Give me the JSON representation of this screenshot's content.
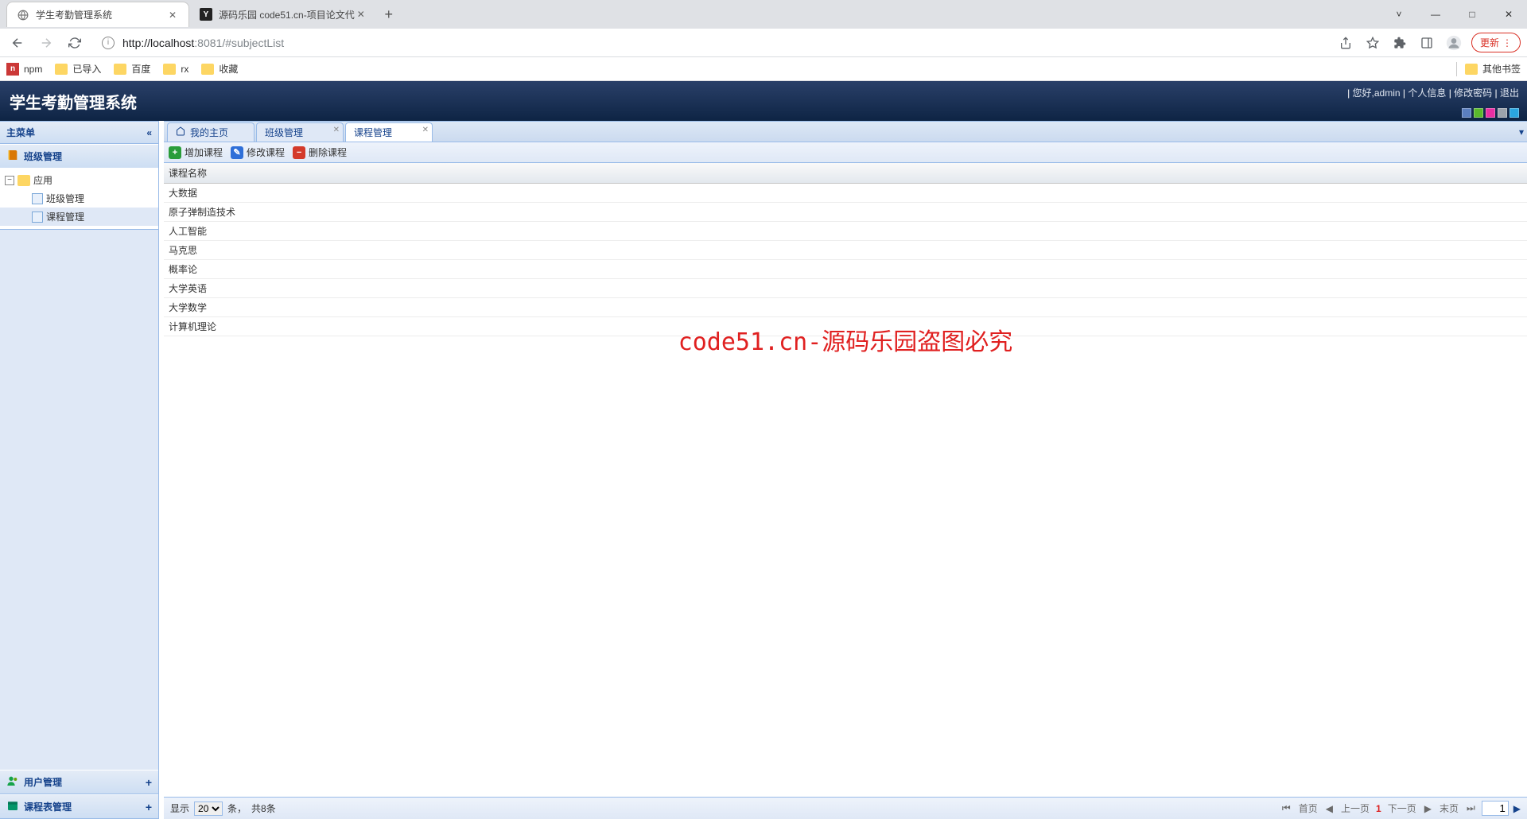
{
  "browser": {
    "tabs": [
      {
        "title": "学生考勤管理系统",
        "icon": "globe",
        "active": true
      },
      {
        "title": "源码乐园 code51.cn-项目论文代",
        "icon": "y",
        "active": false
      }
    ],
    "url_host": "http://localhost",
    "url_port": ":8081",
    "url_path": "/#subjectList",
    "update_label": "更新",
    "window_controls": {
      "min": "—",
      "max": "□",
      "close": "✕",
      "chevron": "˅"
    },
    "bookmarks": {
      "npm": "npm",
      "items": [
        "已导入",
        "百度",
        "rx",
        "收藏"
      ],
      "other": "其他书签"
    }
  },
  "header": {
    "title": "学生考勤管理系统",
    "links": {
      "greeting": "您好,admin",
      "profile": "个人信息",
      "changepw": "修改密码",
      "logout": "退出"
    },
    "sep": " | ",
    "swatches": [
      "#5b7fbf",
      "#5ab92c",
      "#e82fa3",
      "#9ca3ab",
      "#2aa6e0"
    ]
  },
  "sidebar": {
    "main_menu": "主菜单",
    "sections": {
      "class_mgmt": "班级管理",
      "user_mgmt": "用户管理",
      "schedule_mgmt": "课程表管理"
    },
    "tree": {
      "app": "应用",
      "class_mgmt": "班级管理",
      "course_mgmt": "课程管理"
    }
  },
  "tabs": {
    "home": "我的主页",
    "class": "班级管理",
    "course": "课程管理"
  },
  "toolbar": {
    "add": "增加课程",
    "edit": "修改课程",
    "delete": "删除课程"
  },
  "grid": {
    "header": "课程名称",
    "rows": [
      "大数据",
      "原子弹制造技术",
      "人工智能",
      "马克思",
      "概率论",
      "大学英语",
      "大学数学",
      "计算机理论"
    ]
  },
  "watermark": "code51.cn-源码乐园盗图必究",
  "pager": {
    "show": "显示",
    "page_size": "20",
    "unit": "条，",
    "total": "共8条",
    "first": "首页",
    "prev": "上一页",
    "cur": "1",
    "next": "下一页",
    "last": "末页",
    "input": "1"
  }
}
